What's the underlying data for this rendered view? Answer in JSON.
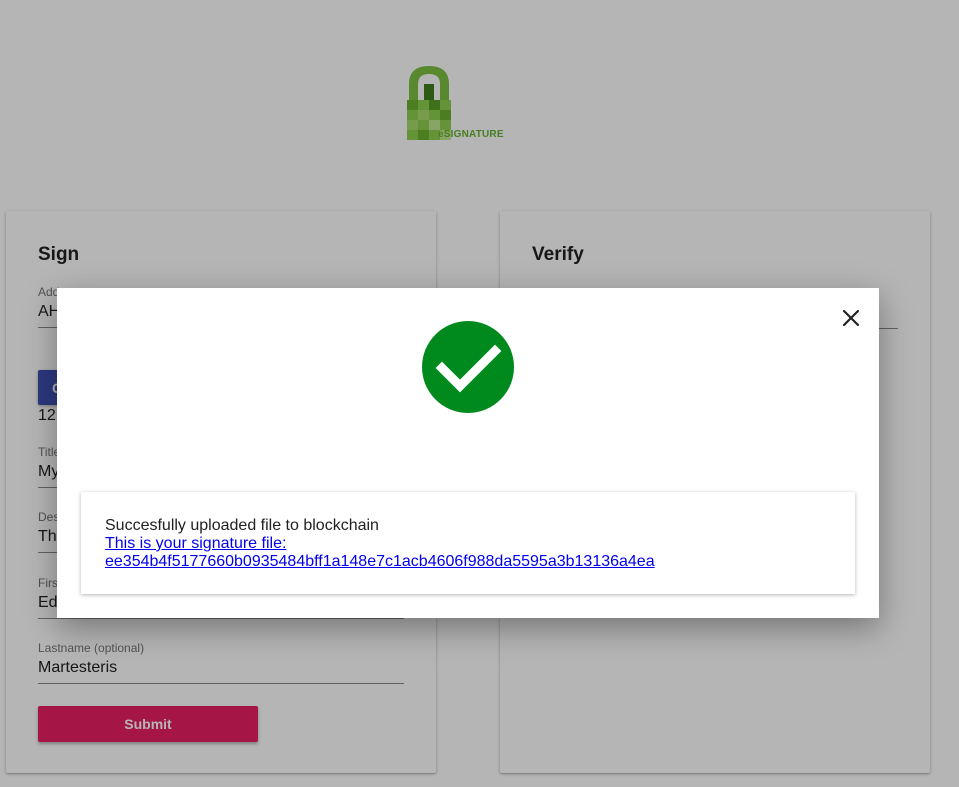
{
  "logo": {
    "text": "eSIGNATURE",
    "color": "#64b22e"
  },
  "sign_card": {
    "title": "Sign",
    "address": {
      "label": "Address",
      "value": "AH"
    },
    "choose_button_label": "C",
    "file_size": "12",
    "title_field": {
      "label": "Title",
      "value": "My"
    },
    "description_field": {
      "label": "Des",
      "value": "Th"
    },
    "firstname_field": {
      "label": "Firs",
      "value": "Ed"
    },
    "lastname_field": {
      "label": "Lastname (optional)",
      "value": "Martesteris"
    },
    "submit_label": "Submit"
  },
  "verify_card": {
    "title": "Verify"
  },
  "modal": {
    "close_icon": "close-icon",
    "status_icon": "check-circle-icon",
    "status_color": "#008a1e",
    "message": "Succesfully uploaded file to blockchain",
    "link_line1": "This is your signature file:",
    "link_line2": "ee354b4f5177660b0935484bff1a148e7c1acb4606f988da5595a3b13136a4ea"
  },
  "colors": {
    "primary": "#3f51b5",
    "accent": "#e91e63",
    "link": "#0000ee"
  }
}
